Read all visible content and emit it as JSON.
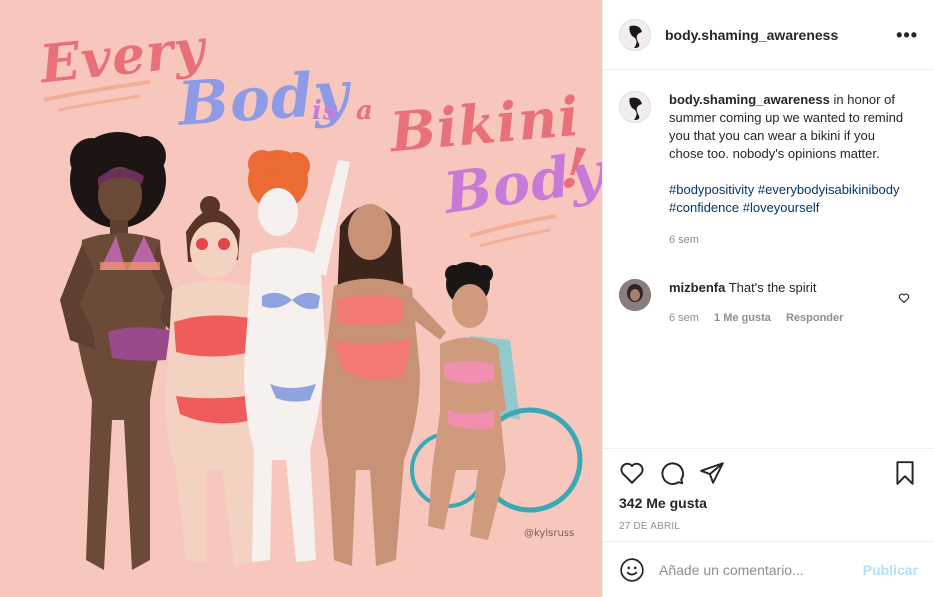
{
  "artwork": {
    "headline_every": "Every",
    "headline_body": "Body",
    "headline_is": "is",
    "headline_a": "a",
    "headline_bikini": "Bikini",
    "headline_body2": "Body",
    "headline_excl": "!",
    "signature": "@kylsruss"
  },
  "header": {
    "username": "body.shaming_awareness",
    "more_label": "•••"
  },
  "caption": {
    "username": "body.shaming_awareness",
    "text": "in honor of summer coming up we wanted to remind you that you can wear a bikini if you chose too. nobody's opinions matter.",
    "hashtags": "#bodypositivity #everybodyisabikinibody #confidence #loveyourself",
    "time": "6 sem"
  },
  "comment": {
    "username": "mizbenfa",
    "text": "That's the spirit",
    "time": "6 sem",
    "likes": "1 Me gusta",
    "reply": "Responder"
  },
  "actions": {
    "likes": "342 Me gusta",
    "date": "27 DE ABRIL"
  },
  "add_comment": {
    "placeholder": "Añade un comentario...",
    "publish": "Publicar"
  },
  "colors": {
    "background_art": "#f7c7bd",
    "hashtag": "#00376b",
    "publish_disabled": "#b2dffc",
    "muted": "#8e8e8e"
  }
}
